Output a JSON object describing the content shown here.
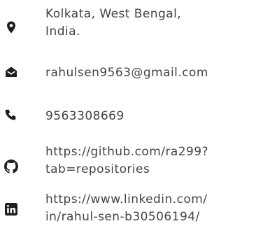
{
  "contact": {
    "address": {
      "icon": "map-marker-icon",
      "line1": "Kolkata, West Bengal,",
      "line2": "India."
    },
    "email": {
      "icon": "envelope-open-icon",
      "value": "rahulsen9563@gmail.com"
    },
    "phone": {
      "icon": "phone-icon",
      "value": "9563308669"
    },
    "github": {
      "icon": "github-icon",
      "line1": "https://github.com/ra299?",
      "line2": "tab=repositories"
    },
    "linkedin": {
      "icon": "linkedin-icon",
      "line1": "https://www.linkedin.com/",
      "line2": "in/rahul-sen-b30506194/"
    }
  },
  "colors": {
    "text": "#444444",
    "icon": "#1f1f1f",
    "background": "#ffffff"
  }
}
